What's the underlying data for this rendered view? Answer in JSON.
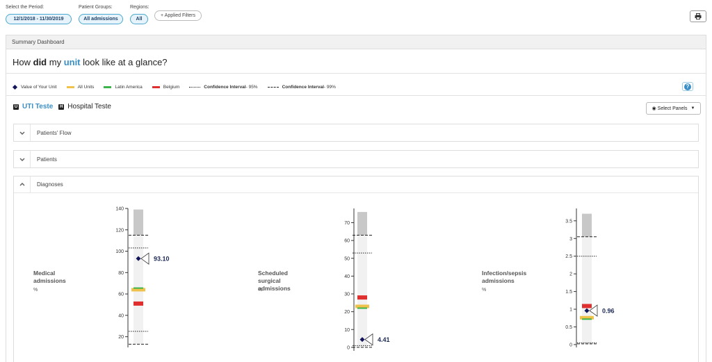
{
  "filters": {
    "period": {
      "label": "Select the Period:",
      "value": "12/1/2018 - 11/30/2019"
    },
    "patient_groups": {
      "label": "Patient Groups:",
      "value": "All admissions"
    },
    "regions": {
      "label": "Regions:",
      "value": "All"
    },
    "applied_filters_label": "+ Applied Filters"
  },
  "panel": {
    "heading": "Summary Dashboard",
    "question": {
      "part1": "How ",
      "bold": "did",
      "part2": " my ",
      "unit": "unit",
      "part3": " look like at a glance?"
    }
  },
  "legend": {
    "items": [
      {
        "label": "Value of Your Unit",
        "color": "#14165a"
      },
      {
        "label": "All Units",
        "color": "#f0c14b"
      },
      {
        "label": "Latin America",
        "color": "#3cb44b"
      },
      {
        "label": "Belgium",
        "color": "#e02f2f"
      }
    ],
    "ci95": {
      "bold": "Confidence Interval",
      "suffix": " - 95%"
    },
    "ci99": {
      "bold": "Confidence Interval",
      "suffix": " - 99%"
    }
  },
  "units": {
    "active": {
      "icon": "U",
      "label": "UTI Teste"
    },
    "other": {
      "icon": "H",
      "label": "Hospital Teste"
    },
    "select_panels": "Select Panels"
  },
  "sections": [
    {
      "label": "Patients' Flow",
      "expanded": false
    },
    {
      "label": "Patients",
      "expanded": false
    },
    {
      "label": "Diagnoses",
      "expanded": true
    }
  ],
  "chart_data": [
    {
      "type": "box",
      "title": "Medical\nadmissions",
      "unit": "%",
      "ylim": [
        10,
        140
      ],
      "ticks": [
        20,
        40,
        60,
        80,
        100,
        120,
        140
      ],
      "range_top": 139,
      "ci99": [
        13,
        115
      ],
      "ci95": [
        25,
        103
      ],
      "all_units": 64,
      "latin_america": 65.5,
      "belgium": 51,
      "value": 93.1,
      "value_label": "93.10"
    },
    {
      "type": "box",
      "title": "Scheduled surgical\nadmissions",
      "unit": "%",
      "ylim": [
        -2,
        78
      ],
      "ticks": [
        0,
        10,
        20,
        30,
        40,
        50,
        60,
        70
      ],
      "range_top": 76,
      "ci99": [
        0,
        63
      ],
      "ci95": [
        1,
        53
      ],
      "all_units": 23,
      "latin_america": 22,
      "belgium": 28,
      "value": 4.41,
      "value_label": "4.41"
    },
    {
      "type": "box",
      "title": "Infection/sepsis\nadmissions",
      "unit": "%",
      "ylim": [
        -0.08,
        3.85
      ],
      "ticks": [
        0,
        0.5,
        1,
        1.5,
        2,
        2.5,
        3,
        3.5
      ],
      "tick_labels": [
        "0",
        "0.5",
        "1",
        "1.5",
        "2",
        "2.5",
        "3",
        "3.5"
      ],
      "range_top": 3.7,
      "ci99": [
        0.02,
        3.05
      ],
      "ci95": [
        0.05,
        2.5
      ],
      "all_units": 0.76,
      "latin_america": 0.72,
      "belgium": 1.09,
      "value": 0.96,
      "value_label": "0.96"
    }
  ]
}
